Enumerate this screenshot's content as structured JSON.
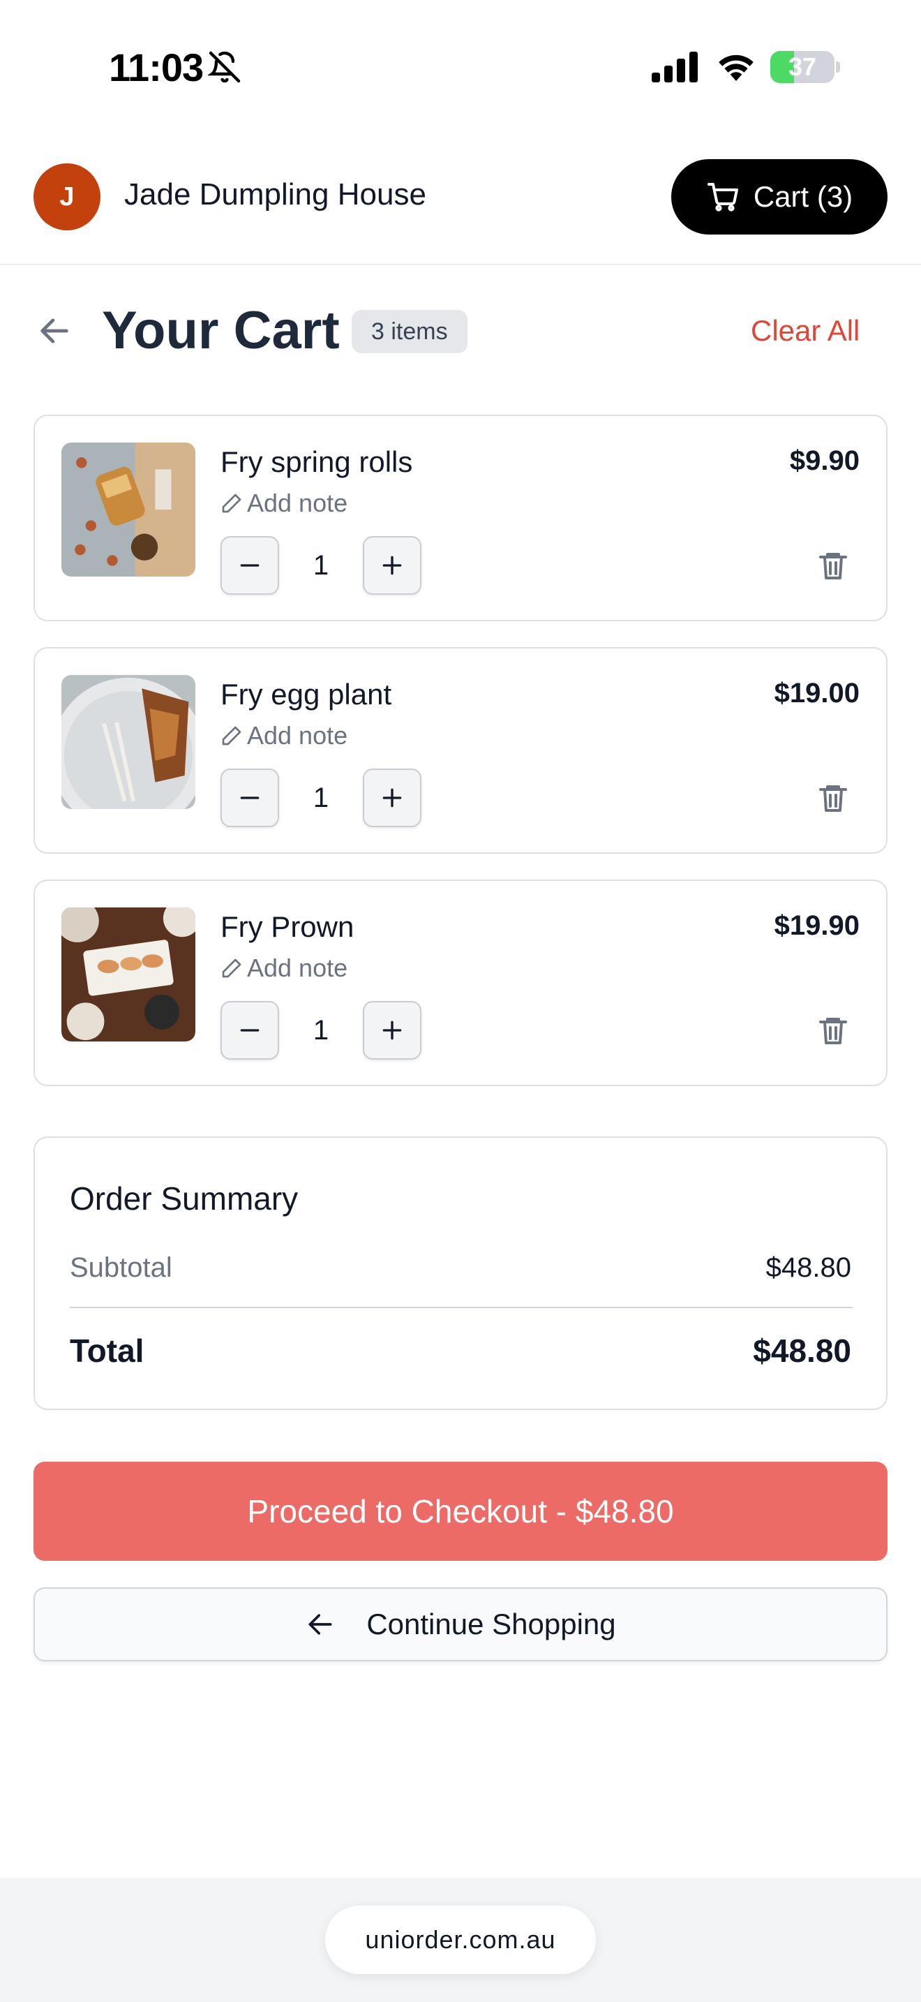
{
  "status_bar": {
    "time": "11:03",
    "battery": "37",
    "battery_level": 0.37,
    "battery_color": "#4cd964"
  },
  "header": {
    "avatar_letter": "J",
    "avatar_color": "#c2410c",
    "restaurant_name": "Jade Dumpling House",
    "cart_label": "Cart (3)"
  },
  "title_row": {
    "title": "Your Cart",
    "count_badge": "3 items",
    "clear_all": "Clear All"
  },
  "items": [
    {
      "name": "Fry spring rolls",
      "note_label": "Add note",
      "price": "$9.90",
      "quantity": "1"
    },
    {
      "name": "Fry egg plant",
      "note_label": "Add note",
      "price": "$19.00",
      "quantity": "1"
    },
    {
      "name": "Fry Prown",
      "note_label": "Add note",
      "price": "$19.90",
      "quantity": "1"
    }
  ],
  "summary": {
    "title": "Order Summary",
    "subtotal_label": "Subtotal",
    "subtotal_value": "$48.80",
    "total_label": "Total",
    "total_value": "$48.80"
  },
  "actions": {
    "checkout_label": "Proceed to Checkout - $48.80",
    "checkout_color": "#ec6b66",
    "continue_label": "Continue Shopping"
  },
  "browser": {
    "url": "uniorder.com.au"
  },
  "icons": [
    "bell-slash-icon",
    "signal-icon",
    "wifi-icon",
    "cart-icon",
    "back-arrow-icon",
    "pencil-icon",
    "minus-icon",
    "plus-icon",
    "trash-icon",
    "arrow-left-icon"
  ]
}
